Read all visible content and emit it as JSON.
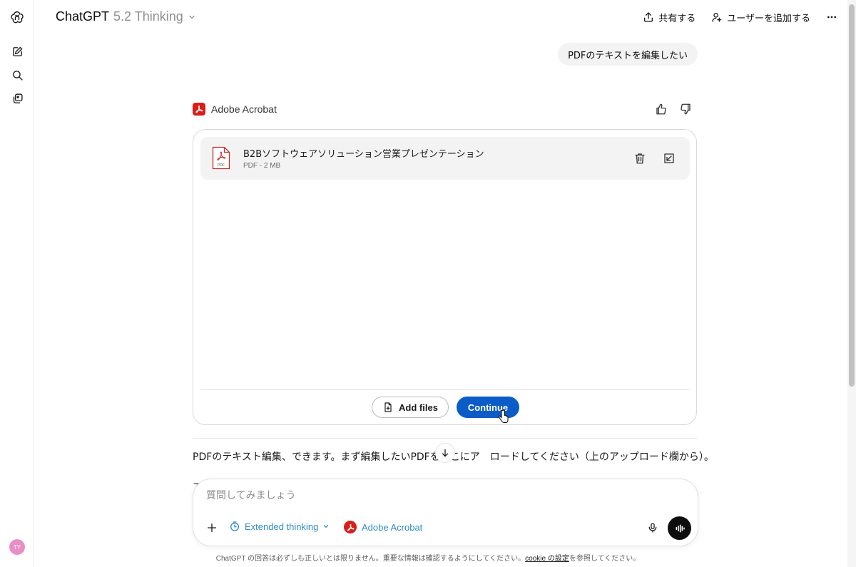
{
  "header": {
    "model_name": "ChatGPT",
    "model_version": "5.2 Thinking",
    "share_label": "共有する",
    "add_user_label": "ユーザーを追加する"
  },
  "sidebar": {
    "avatar_initials": "TY",
    "items": [
      {
        "icon": "new-chat-icon"
      },
      {
        "icon": "search-icon"
      },
      {
        "icon": "library-icon"
      }
    ]
  },
  "conversation": {
    "user_message": "PDFのテキストを編集したい",
    "plugin_name": "Adobe Acrobat",
    "file": {
      "title": "B2Bソフトウェアソリューション営業プレゼンテーション",
      "meta": "PDF - 2 MB",
      "icon_label": "PDF"
    },
    "add_files_label": "Add files",
    "continue_label": "Continue",
    "assistant_text_before": "PDFのテキスト編集、できます。まず編集したいPDFをここにア",
    "assistant_text_after": "ロードしてください（上のアップロード欄から）。",
    "assistant_peek": "ア"
  },
  "composer": {
    "placeholder": "質問してみましょう",
    "thinking_label": "Extended thinking",
    "acrobat_label": "Adobe Acrobat"
  },
  "footer": {
    "disclaimer_before": "ChatGPT の回答は必ずしも正しいとは限りません。重要な情報は確認するようにしてください。",
    "cookie_link": "cookie の設定",
    "disclaimer_after": "を参照してください。"
  },
  "colors": {
    "accent_blue": "#0b5cc7",
    "link_blue": "#2d8bc8",
    "acrobat_red": "#d91e18"
  }
}
